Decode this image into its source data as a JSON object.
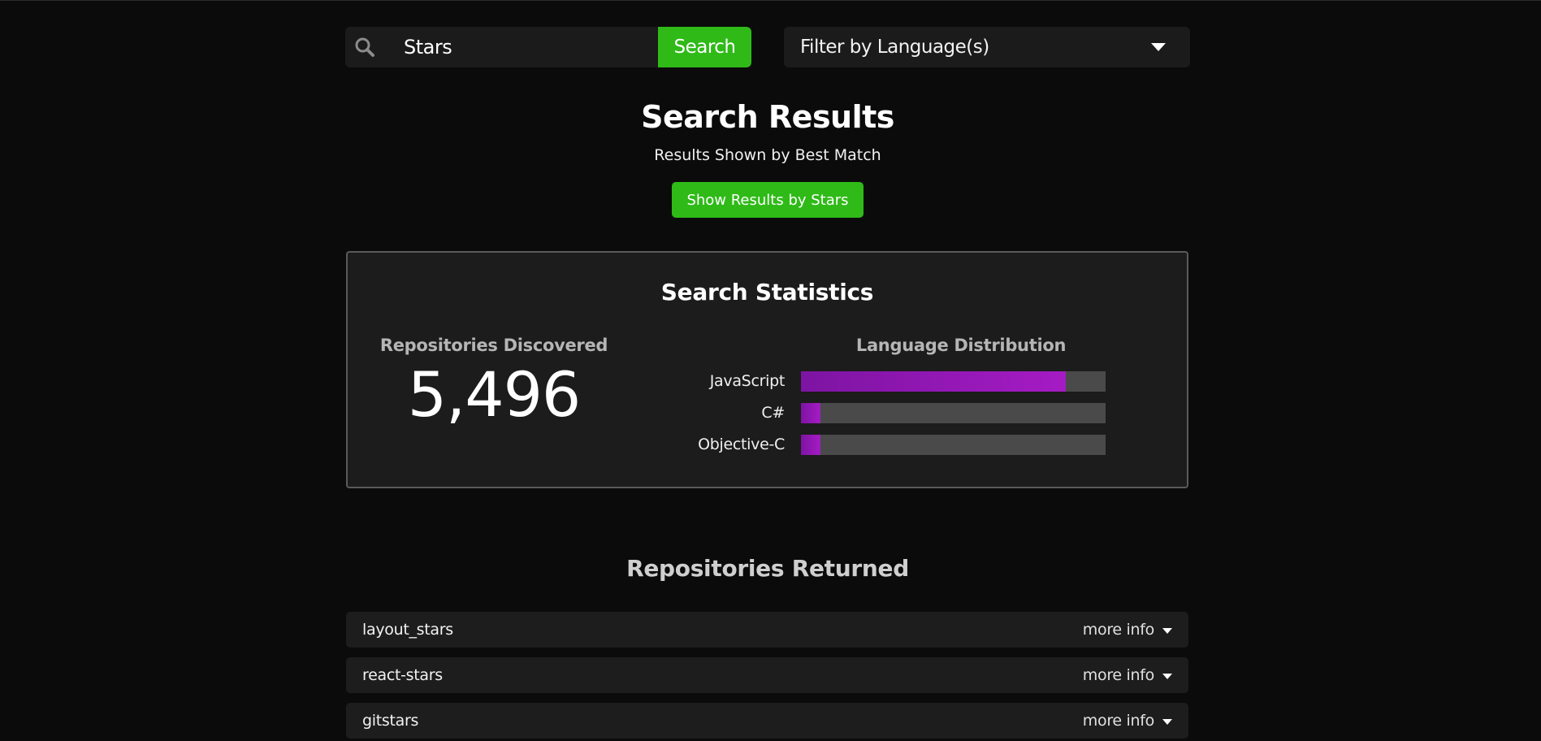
{
  "search": {
    "value": "Stars",
    "button_label": "Search",
    "icon": "search-icon"
  },
  "filter": {
    "label": "Filter by Language(s)",
    "icon": "chevron-down-icon"
  },
  "header": {
    "title": "Search Results",
    "subtitle": "Results Shown by Best Match",
    "sort_button_label": "Show Results by Stars"
  },
  "stats": {
    "title": "Search Statistics",
    "repositories_label": "Repositories Discovered",
    "repositories_count": "5,496",
    "language_title": "Language Distribution",
    "languages": [
      {
        "name": "JavaScript",
        "fraction": 0.87
      },
      {
        "name": "C#",
        "fraction": 0.065
      },
      {
        "name": "Objective-C",
        "fraction": 0.065
      }
    ],
    "bar_color": "#a51bc4",
    "track_color": "#4a4a4a"
  },
  "repos": {
    "title": "Repositories Returned",
    "items": [
      {
        "name": "layout_stars",
        "more_label": "more info"
      },
      {
        "name": "react-stars",
        "more_label": "more info"
      },
      {
        "name": "gitstars",
        "more_label": "more info"
      }
    ]
  },
  "colors": {
    "accent": "#2fba18",
    "background": "#0b0b0b"
  }
}
